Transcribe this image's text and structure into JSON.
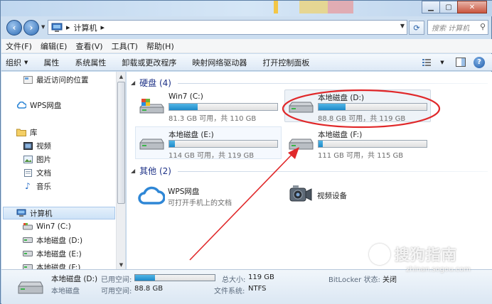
{
  "address": {
    "path": [
      "计算机"
    ],
    "search_placeholder": "搜索 计算机"
  },
  "menu": [
    "文件(F)",
    "编辑(E)",
    "查看(V)",
    "工具(T)",
    "帮助(H)"
  ],
  "toolbar": {
    "organize": "组织",
    "items": [
      "属性",
      "系统属性",
      "卸载或更改程序",
      "映射网络驱动器",
      "打开控制面板"
    ]
  },
  "nav": {
    "recent": "最近访问的位置",
    "wps": "WPS网盘",
    "library": "库",
    "library_items": [
      "视频",
      "图片",
      "文档",
      "音乐"
    ],
    "computer": "计算机",
    "computer_items": [
      "Win7 (C:)",
      "本地磁盘 (D:)",
      "本地磁盘 (E:)",
      "本地磁盘 (F:)"
    ]
  },
  "groups": {
    "drives_header": "硬盘 (4)",
    "other_header": "其他 (2)"
  },
  "drives": [
    {
      "name": "Win7 (C:)",
      "info": "81.3 GB 可用，共 110 GB",
      "used_fraction": 0.26
    },
    {
      "name": "本地磁盘 (D:)",
      "info": "88.8 GB 可用，共 119 GB",
      "used_fraction": 0.25
    },
    {
      "name": "本地磁盘 (E:)",
      "info": "114 GB 可用，共 119 GB",
      "used_fraction": 0.05
    },
    {
      "name": "本地磁盘 (F:)",
      "info": "111 GB 可用，共 115 GB",
      "used_fraction": 0.04
    }
  ],
  "other": [
    {
      "name": "WPS网盘",
      "desc": "可打开手机上的文档"
    },
    {
      "name": "视频设备",
      "desc": ""
    }
  ],
  "details": {
    "name": "本地磁盘 (D:)",
    "type": "本地磁盘",
    "used_label": "已用空间:",
    "free_label": "可用空间:",
    "free_value": "88.8 GB",
    "total_label": "总大小:",
    "total_value": "119 GB",
    "fs_label": "文件系统:",
    "fs_value": "NTFS",
    "bitlocker_label": "BitLocker 状态:",
    "bitlocker_value": "关闭",
    "used_fraction": 0.25
  },
  "watermark": {
    "glyph": "S",
    "text": "搜狗指南",
    "url": "zhinan.sogou.com"
  },
  "colors": {
    "annotation_red": "#e0282a",
    "drive_bar": "#26a0da",
    "group_header": "#1e3287"
  }
}
